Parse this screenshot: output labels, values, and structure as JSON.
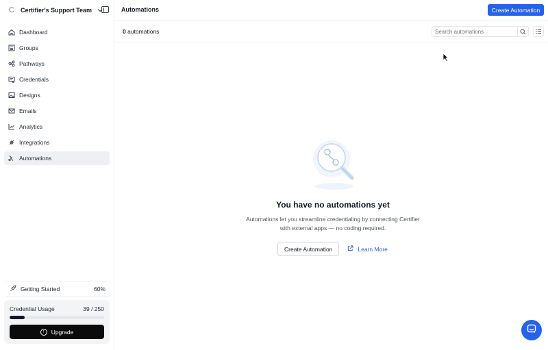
{
  "team": {
    "logo_letter": "C",
    "name": "Certifier's Support Team"
  },
  "sidebar": {
    "items": [
      {
        "label": "Dashboard",
        "icon": "home-icon",
        "active": false
      },
      {
        "label": "Groups",
        "icon": "groups-icon",
        "active": false
      },
      {
        "label": "Pathways",
        "icon": "pathways-icon",
        "active": false
      },
      {
        "label": "Credentials",
        "icon": "credentials-icon",
        "active": false
      },
      {
        "label": "Designs",
        "icon": "designs-icon",
        "active": false
      },
      {
        "label": "Emails",
        "icon": "mail-icon",
        "active": false
      },
      {
        "label": "Analytics",
        "icon": "analytics-icon",
        "active": false
      },
      {
        "label": "Integrations",
        "icon": "integrations-icon",
        "active": false
      },
      {
        "label": "Automations",
        "icon": "automations-icon",
        "active": true
      }
    ],
    "getting_started": {
      "label": "Getting Started",
      "percent": "60%"
    },
    "usage": {
      "label": "Credential Usage",
      "value": "39 / 250",
      "used": 39,
      "total": 250,
      "upgrade_label": "Upgrade"
    }
  },
  "header": {
    "title": "Automations",
    "create_label": "Create Automation"
  },
  "toolbar": {
    "count_number": "0",
    "count_label": "automations",
    "search_placeholder": "Search automations"
  },
  "empty_state": {
    "title": "You have no automations yet",
    "desc_line1": "Automations let you streamline credentialing by connecting Certifier",
    "desc_line2": "with external apps — no coding required.",
    "create_label": "Create Automation",
    "learn_label": "Learn More"
  },
  "colors": {
    "accent": "#2563eb",
    "active_bg": "#eef0f3",
    "dark": "#0b0b0c"
  }
}
